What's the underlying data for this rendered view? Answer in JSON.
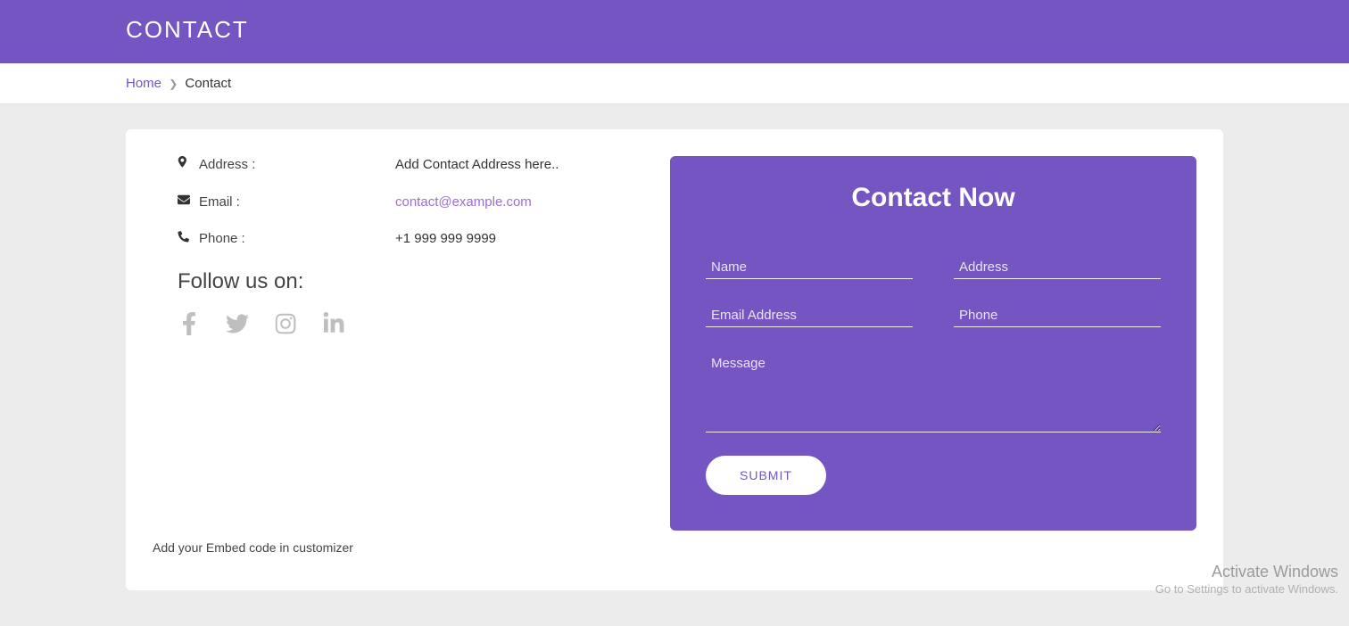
{
  "header": {
    "title": "CONTACT"
  },
  "breadcrumb": {
    "home": "Home",
    "current": "Contact"
  },
  "info": {
    "address_label": "Address :",
    "address_value": "Add Contact Address here..",
    "email_label": "Email :",
    "email_value": "contact@example.com",
    "phone_label": "Phone :",
    "phone_value": "+1 999 999 9999"
  },
  "follow_heading": "Follow us on:",
  "social": {
    "facebook": "facebook-icon",
    "twitter": "twitter-icon",
    "instagram": "instagram-icon",
    "linkedin": "linkedin-icon"
  },
  "embed_note": "Add your Embed code in customizer",
  "form": {
    "title": "Contact Now",
    "name_ph": "Name",
    "address_ph": "Address",
    "email_ph": "Email Address",
    "phone_ph": "Phone",
    "message_ph": "Message",
    "submit": "SUBMIT"
  },
  "watermark": {
    "line1": "Activate Windows",
    "line2": "Go to Settings to activate Windows."
  }
}
